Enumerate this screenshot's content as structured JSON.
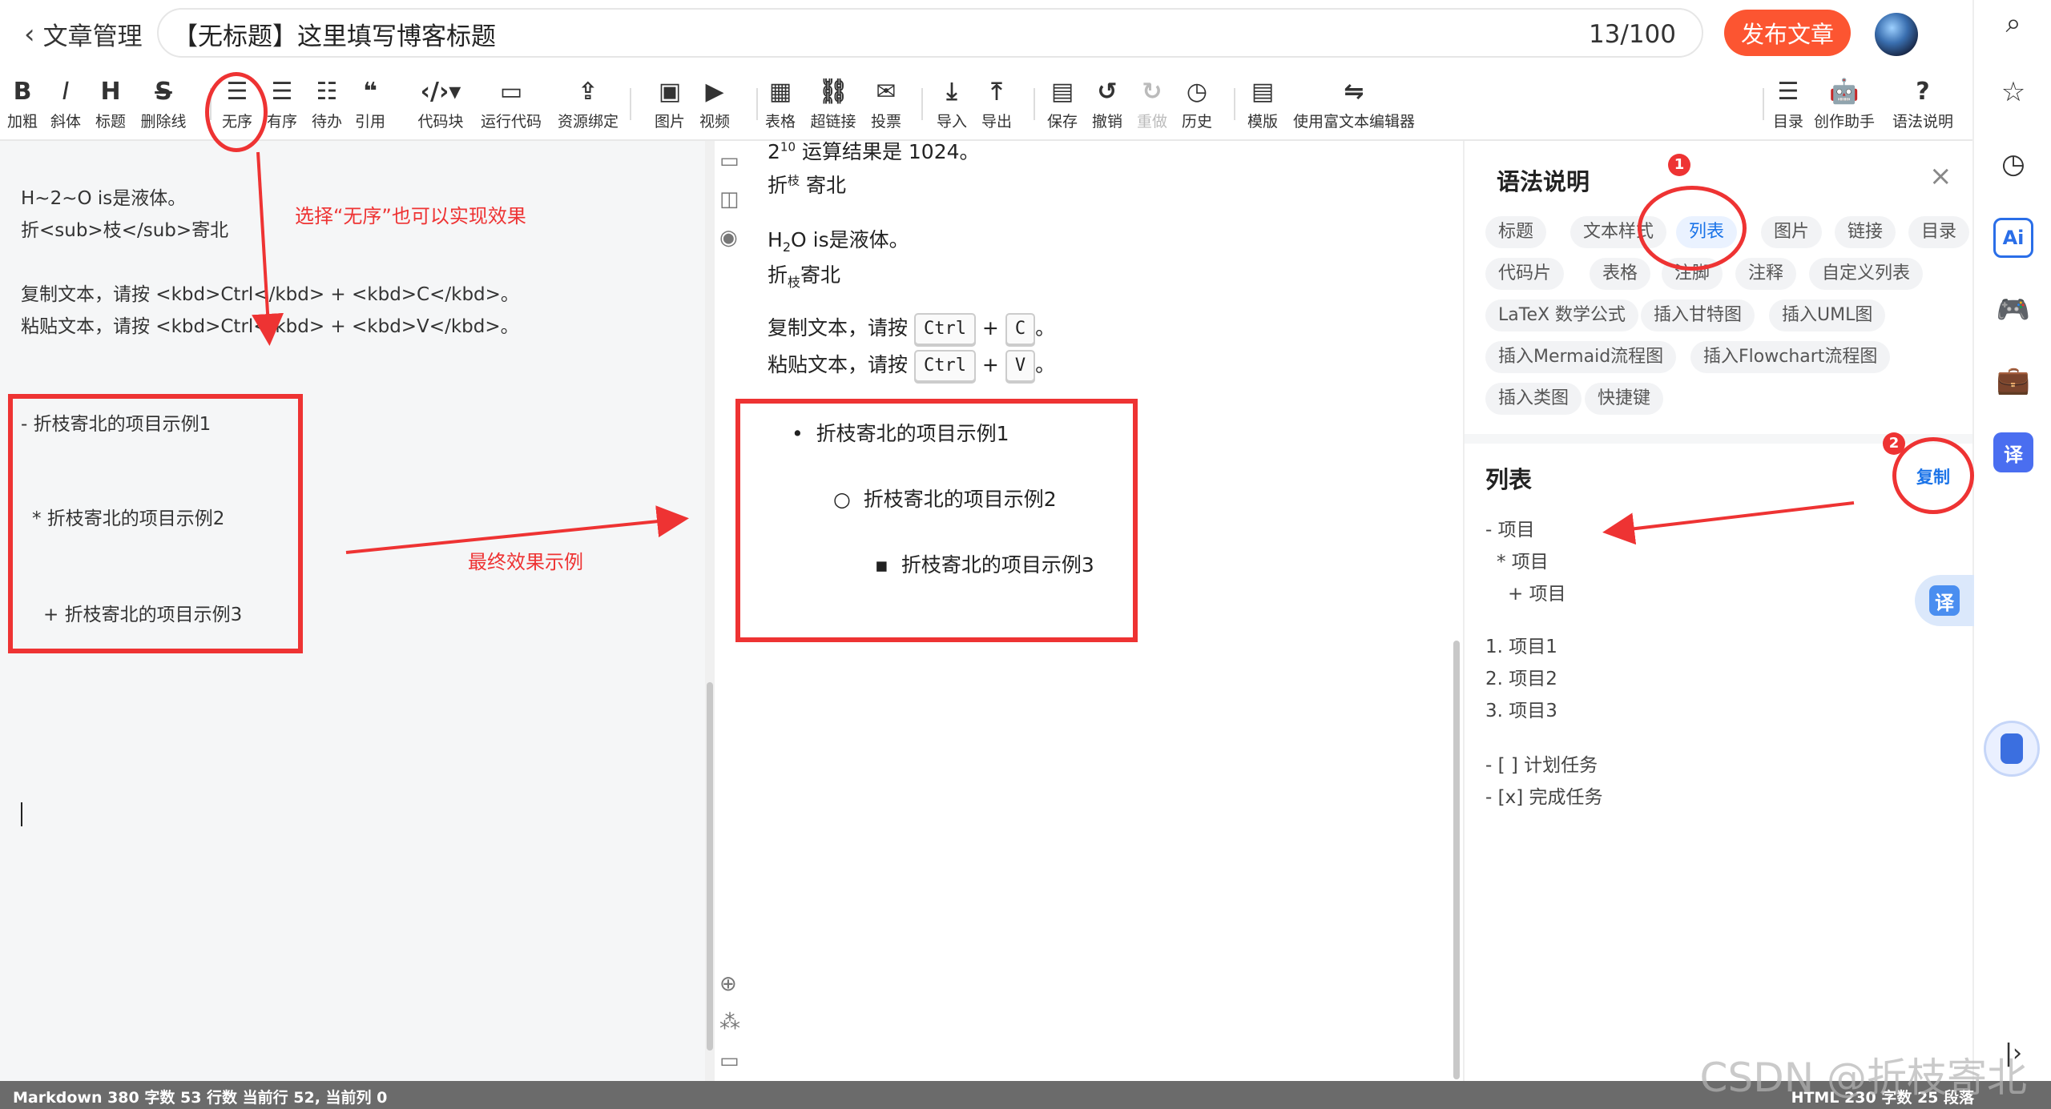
{
  "header": {
    "back_label": "文章管理",
    "title_value": "【无标题】这里填写博客标题",
    "title_count": "13/100",
    "publish_label": "发布文章"
  },
  "toolbar": [
    {
      "icon": "bold-icon",
      "glyph": "B",
      "label": "加粗"
    },
    {
      "icon": "italic-icon",
      "glyph": "I",
      "label": "斜体"
    },
    {
      "icon": "heading-icon",
      "glyph": "H",
      "label": "标题"
    },
    {
      "icon": "strike-icon",
      "glyph": "S",
      "label": "删除线"
    },
    {
      "icon": "unordered-list-icon",
      "glyph": "☰",
      "label": "无序"
    },
    {
      "icon": "ordered-list-icon",
      "glyph": "☰",
      "label": "有序"
    },
    {
      "icon": "todo-icon",
      "glyph": "☷",
      "label": "待办"
    },
    {
      "icon": "quote-icon",
      "glyph": "❝",
      "label": "引用"
    },
    {
      "icon": "code-block-icon",
      "glyph": "‹/›▾",
      "label": "代码块"
    },
    {
      "icon": "run-code-icon",
      "glyph": "▭",
      "label": "运行代码"
    },
    {
      "icon": "resource-bind-icon",
      "glyph": "⇪",
      "label": "资源绑定"
    },
    {
      "icon": "image-icon",
      "glyph": "▣",
      "label": "图片"
    },
    {
      "icon": "video-icon",
      "glyph": "▶",
      "label": "视频"
    },
    {
      "icon": "table-icon",
      "glyph": "▦",
      "label": "表格"
    },
    {
      "icon": "link-icon",
      "glyph": "⛓",
      "label": "超链接"
    },
    {
      "icon": "vote-icon",
      "glyph": "✉",
      "label": "投票"
    },
    {
      "icon": "import-icon",
      "glyph": "⤓",
      "label": "导入"
    },
    {
      "icon": "export-icon",
      "glyph": "⤒",
      "label": "导出"
    },
    {
      "icon": "save-icon",
      "glyph": "▤",
      "label": "保存"
    },
    {
      "icon": "undo-icon",
      "glyph": "↺",
      "label": "撤销"
    },
    {
      "icon": "redo-icon",
      "glyph": "↻",
      "label": "重做"
    },
    {
      "icon": "history-icon",
      "glyph": "◷",
      "label": "历史"
    },
    {
      "icon": "template-icon",
      "glyph": "▤",
      "label": "模版"
    },
    {
      "icon": "rich-editor-icon",
      "glyph": "⇋",
      "label": "使用富文本编辑器"
    },
    {
      "icon": "toc-icon",
      "glyph": "☰",
      "label": "目录"
    },
    {
      "icon": "assistant-icon",
      "glyph": "🤖",
      "label": "创作助手"
    },
    {
      "icon": "help-icon",
      "glyph": "?",
      "label": "语法说明"
    }
  ],
  "editor": {
    "lines": [
      "H~2~O is是液体。",
      "折<sub>枝</sub>寄北",
      "复制文本，请按 <kbd>Ctrl</kbd> + <kbd>C</kbd>。",
      "粘贴文本，请按 <kbd>Ctrl</kbd> + <kbd>V</kbd>。",
      "- 折枝寄北的项目示例1",
      "* 折枝寄北的项目示例2",
      "+ 折枝寄北的项目示例3"
    ]
  },
  "preview": {
    "power_line": "运算结果是 1024。",
    "power_base": "2",
    "power_exp": "10",
    "sup_pre": "折",
    "sup_char": "枝",
    "sup_post": " 寄北",
    "h2o_pre": "H",
    "h2o_sub": "2",
    "h2o_post": "O is是液体。",
    "sub_pre": "折",
    "sub_char": "枝",
    "sub_post": "寄北",
    "copy_text": "复制文本，请按",
    "paste_text": "粘贴文本，请按",
    "key_ctrl": "Ctrl",
    "key_c": "C",
    "key_v": "V",
    "plus": "+",
    "period": "。",
    "list_items": [
      "折枝寄北的项目示例1",
      "折枝寄北的项目示例2",
      "折枝寄北的项目示例3"
    ]
  },
  "panel": {
    "title": "语法说明",
    "tags": [
      "标题",
      "文本样式",
      "列表",
      "图片",
      "链接",
      "目录",
      "代码片",
      "表格",
      "注脚",
      "注释",
      "自定义列表",
      "LaTeX 数学公式",
      "插入甘特图",
      "插入UML图",
      "插入Mermaid流程图",
      "插入Flowchart流程图",
      "插入类图",
      "快捷键"
    ],
    "active_tag": "列表",
    "section_title": "列表",
    "copy_label": "复制",
    "examples": [
      "- 项目",
      "* 项目",
      "+ 项目",
      "1. 项目1",
      "2. 项目2",
      "3. 项目3",
      "- [ ] 计划任务",
      "- [x] 完成任务"
    ]
  },
  "annotations": {
    "hint": "选择“无序”也可以实现效果",
    "final": "最终效果示例",
    "badge1": "1",
    "badge2": "2"
  },
  "status": {
    "left": "Markdown  380 字数  53 行数  当前行 52, 当前列 0",
    "right": "HTML  230 字数  25 段落"
  },
  "watermark": "CSDN @折枝寄北",
  "rail": {
    "ai_label": "Ai",
    "translate_label": "译"
  },
  "colors": {
    "accent": "#fc5531",
    "annotation": "#e33333",
    "link": "#1a73e8"
  }
}
